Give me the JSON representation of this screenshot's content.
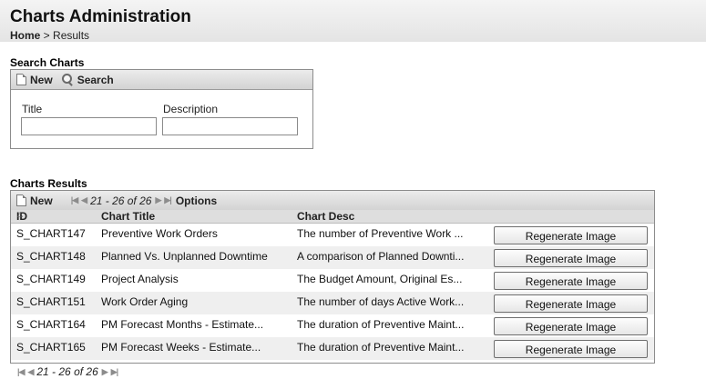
{
  "header": {
    "title": "Charts Administration",
    "breadcrumb": {
      "home": "Home",
      "separator": " > ",
      "current": "Results"
    }
  },
  "search": {
    "section_title": "Search Charts",
    "toolbar": {
      "new_label": "New",
      "search_label": "Search"
    },
    "fields": {
      "title_label": "Title",
      "title_value": "",
      "description_label": "Description",
      "description_value": ""
    }
  },
  "results": {
    "section_title": "Charts Results",
    "toolbar": {
      "new_label": "New",
      "range": "21 - 26 of 26",
      "options_label": "Options"
    },
    "columns": {
      "id": "ID",
      "title": "Chart Title",
      "desc": "Chart Desc"
    },
    "rows": [
      {
        "id": "S_CHART147",
        "title": "Preventive Work Orders",
        "desc": "The number of Preventive Work ...",
        "action": "Regenerate Image"
      },
      {
        "id": "S_CHART148",
        "title": "Planned Vs. Unplanned Downtime",
        "desc": "A comparison of Planned Downti...",
        "action": "Regenerate Image"
      },
      {
        "id": "S_CHART149",
        "title": "Project Analysis",
        "desc": "The Budget Amount, Original Es...",
        "action": "Regenerate Image"
      },
      {
        "id": "S_CHART151",
        "title": "Work Order Aging",
        "desc": "The number of days Active Work...",
        "action": "Regenerate Image"
      },
      {
        "id": "S_CHART164",
        "title": "PM Forecast Months - Estimate...",
        "desc": "The duration of Preventive Maint...",
        "action": "Regenerate Image"
      },
      {
        "id": "S_CHART165",
        "title": "PM Forecast Weeks - Estimate...",
        "desc": "The duration of Preventive Maint...",
        "action": "Regenerate Image"
      }
    ],
    "bottom_pager": {
      "range": "21 - 26 of 26"
    }
  },
  "icons": {
    "new": "document-icon",
    "search": "magnifier-icon",
    "first": "first-page-icon",
    "prev": "prev-page-icon",
    "next": "next-page-icon",
    "last": "last-page-icon",
    "sort": "sort-ascending-icon"
  },
  "colors": {
    "header_bg": "#e8e8e8",
    "toolbar_bg": "#d8d8d8",
    "row_alt": "#efefef",
    "border": "#8c8c8c"
  }
}
